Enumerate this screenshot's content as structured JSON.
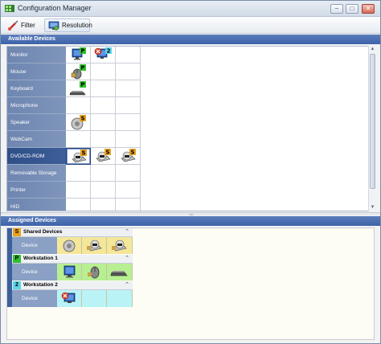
{
  "window": {
    "title": "Configuration Manager",
    "buttons": [
      "–",
      "□",
      "✕"
    ]
  },
  "toolbar": {
    "filter_label": "Filter",
    "resolution_label": "Resolution"
  },
  "available": {
    "header": "Available Devices",
    "rows": [
      {
        "label": "Monitor"
      },
      {
        "label": "Mouse"
      },
      {
        "label": "Keyboard"
      },
      {
        "label": "Microphone"
      },
      {
        "label": "Speaker"
      },
      {
        "label": "WebCam"
      },
      {
        "label": "DVD/CD-ROM"
      },
      {
        "label": "Removable Storage"
      },
      {
        "label": "Printer"
      },
      {
        "label": "HID"
      }
    ],
    "badges": {
      "monitor_1": "P",
      "monitor_2": "2",
      "mouse_1": "P",
      "keyboard_1": "P",
      "speaker_1": "S",
      "dvd_1": "S",
      "dvd_2": "S"
    }
  },
  "assigned": {
    "header": "Assigned Devices",
    "groups": [
      {
        "badge": "S",
        "title": "Shared Devices",
        "row_label": "Device",
        "color": "#f4e79a"
      },
      {
        "badge": "P",
        "title": "Workstation 1",
        "row_label": "Device",
        "color": "#b7ef92"
      },
      {
        "badge": "2",
        "title": "Workstation 2",
        "row_label": "Device",
        "color": "#b9f3f6"
      }
    ],
    "collapse_glyph": "⌃"
  },
  "colors": {
    "header": "#3d63a9",
    "label": "#7f95bb",
    "selected_label": "#2f4f88",
    "shared": "#f4e79a",
    "ws1": "#b7ef92",
    "ws2": "#b9f3f6"
  }
}
